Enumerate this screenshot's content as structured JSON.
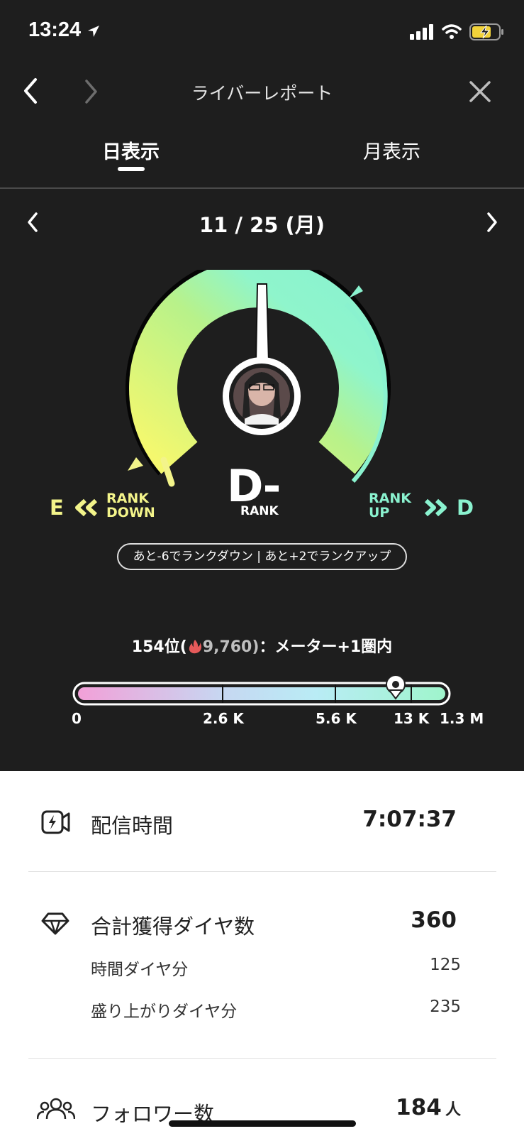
{
  "status_bar": {
    "time": "13:24"
  },
  "nav": {
    "title": "ライバーレポート"
  },
  "tabs": [
    {
      "label": "日表示"
    },
    {
      "label": "月表示"
    }
  ],
  "date": "11 / 25 (月)",
  "gauge": {
    "rank": "D-",
    "rank_caption": "RANK",
    "down": {
      "letter": "E",
      "line1": "RANK",
      "line2": "DOWN"
    },
    "up": {
      "line1": "RANK",
      "line2": "UP",
      "letter": "D"
    },
    "info": "あと-6でランクダウン | あと+2でランクアップ"
  },
  "ranking": {
    "position": "154位(",
    "score": "9,760)",
    "suffix": "：メーター+1圏内",
    "scale_labels": [
      "0",
      "2.6 K",
      "5.6 K",
      "13 K",
      "1.3 M"
    ]
  },
  "stats": {
    "stream_time": {
      "label": "配信時間",
      "value": "7:07:37"
    },
    "diamonds": {
      "label": "合計獲得ダイヤ数",
      "value": "360",
      "time_label": "時間ダイヤ分",
      "time_value": "125",
      "hype_label": "盛り上がりダイヤ分",
      "hype_value": "235"
    },
    "followers": {
      "label": "フォロワー数",
      "value": "184",
      "unit": "人"
    }
  },
  "colors": {
    "dark_bg": "#1e1e1e",
    "down_yellow": "#f3f48a",
    "up_mint": "#8af2cf"
  }
}
